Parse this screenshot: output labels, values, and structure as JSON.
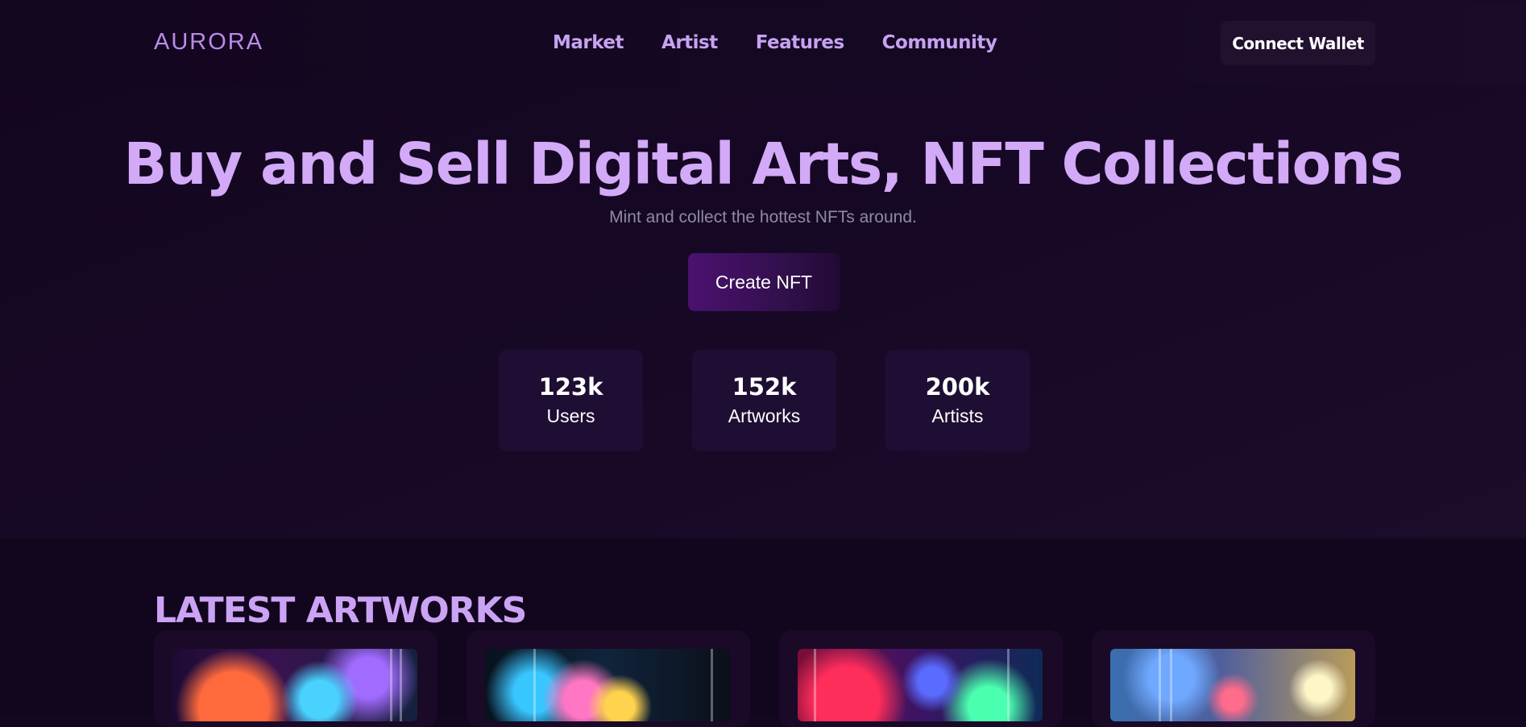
{
  "brand": {
    "logo": "AURORA"
  },
  "nav": {
    "items": [
      {
        "label": "Market"
      },
      {
        "label": "Artist"
      },
      {
        "label": "Features"
      },
      {
        "label": "Community"
      }
    ],
    "connect_label": "Connect Wallet"
  },
  "hero": {
    "title": "Buy and Sell Digital Arts, NFT Collections",
    "subtitle": "Mint and collect the hottest NFTs around.",
    "cta_label": "Create NFT"
  },
  "stats": [
    {
      "value": "123k",
      "label": "Users"
    },
    {
      "value": "152k",
      "label": "Artworks"
    },
    {
      "value": "200k",
      "label": "Artists"
    }
  ],
  "latest": {
    "title": "LATEST ARTWORKS",
    "cards": [
      {
        "image": "abstract-neon-city-artwork"
      },
      {
        "image": "abstract-cyber-spheres-artwork"
      },
      {
        "image": "abstract-vibrant-orbs-artwork"
      },
      {
        "image": "abstract-skyline-sunset-artwork"
      }
    ]
  },
  "colors": {
    "background": "#13061f",
    "accent": "#c7a2f1",
    "title": "#d3aaf7",
    "card": "#1f0e33",
    "button_gradient_start": "#4b1170"
  }
}
